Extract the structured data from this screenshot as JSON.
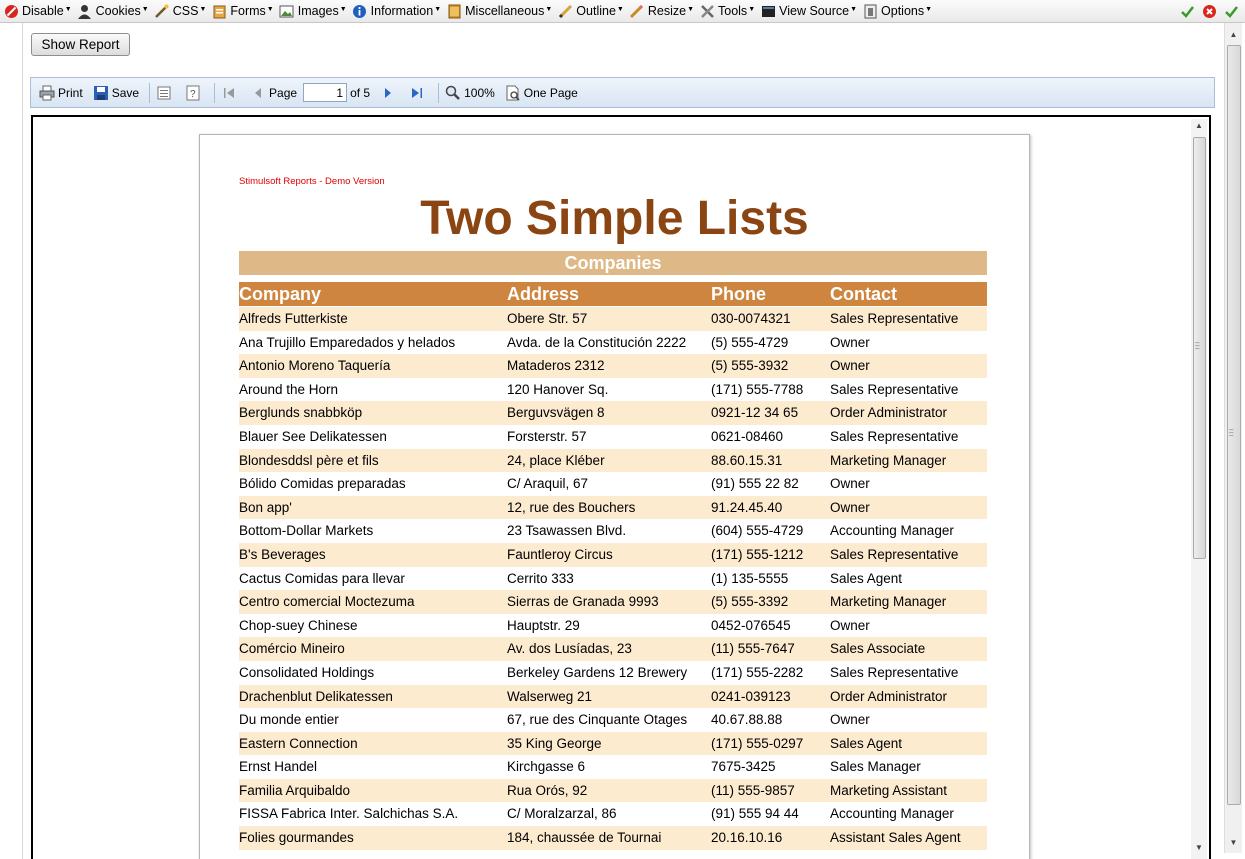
{
  "devbar": {
    "items": [
      {
        "label": "Disable",
        "icon": "disable-icon"
      },
      {
        "label": "Cookies",
        "icon": "cookies-icon"
      },
      {
        "label": "CSS",
        "icon": "css-icon"
      },
      {
        "label": "Forms",
        "icon": "forms-icon"
      },
      {
        "label": "Images",
        "icon": "images-icon"
      },
      {
        "label": "Information",
        "icon": "information-icon"
      },
      {
        "label": "Miscellaneous",
        "icon": "miscellaneous-icon"
      },
      {
        "label": "Outline",
        "icon": "outline-icon"
      },
      {
        "label": "Resize",
        "icon": "resize-icon"
      },
      {
        "label": "Tools",
        "icon": "tools-icon"
      },
      {
        "label": "View Source",
        "icon": "view-source-icon"
      },
      {
        "label": "Options",
        "icon": "options-icon"
      }
    ]
  },
  "show_report_label": "Show Report",
  "viewer": {
    "print_label": "Print",
    "save_label": "Save",
    "page_label": "Page",
    "page_value": "1",
    "page_of": "of 5",
    "zoom_label": "100%",
    "one_page_label": "One Page"
  },
  "report": {
    "demo_note": "Stimulsoft Reports - Demo Version",
    "title": "Two Simple Lists",
    "band_title": "Companies",
    "columns": [
      "Company",
      "Address",
      "Phone",
      "Contact"
    ],
    "rows": [
      [
        "Alfreds Futterkiste",
        "Obere Str. 57",
        "030-0074321",
        "Sales Representative"
      ],
      [
        "Ana Trujillo Emparedados y helados",
        "Avda. de la Constitución 2222",
        "(5) 555-4729",
        "Owner"
      ],
      [
        "Antonio Moreno Taquería",
        "Mataderos 2312",
        "(5) 555-3932",
        "Owner"
      ],
      [
        "Around the Horn",
        "120 Hanover Sq.",
        "(171) 555-7788",
        "Sales Representative"
      ],
      [
        "Berglunds snabbköp",
        "Berguvsvägen 8",
        "0921-12 34 65",
        "Order Administrator"
      ],
      [
        "Blauer See Delikatessen",
        "Forsterstr. 57",
        "0621-08460",
        "Sales Representative"
      ],
      [
        "Blondesddsl père et fils",
        "24, place Kléber",
        "88.60.15.31",
        "Marketing Manager"
      ],
      [
        "Bólido Comidas preparadas",
        "C/ Araquil, 67",
        "(91) 555 22 82",
        "Owner"
      ],
      [
        "Bon app'",
        "12, rue des Bouchers",
        "91.24.45.40",
        "Owner"
      ],
      [
        "Bottom-Dollar Markets",
        "23 Tsawassen Blvd.",
        "(604) 555-4729",
        "Accounting Manager"
      ],
      [
        "B's Beverages",
        "Fauntleroy Circus",
        "(171) 555-1212",
        "Sales Representative"
      ],
      [
        "Cactus Comidas para llevar",
        "Cerrito 333",
        "(1) 135-5555",
        "Sales Agent"
      ],
      [
        "Centro comercial Moctezuma",
        "Sierras de Granada 9993",
        "(5) 555-3392",
        "Marketing Manager"
      ],
      [
        "Chop-suey Chinese",
        "Hauptstr. 29",
        "0452-076545",
        "Owner"
      ],
      [
        "Comércio Mineiro",
        "Av. dos Lusíadas, 23",
        "(11) 555-7647",
        "Sales Associate"
      ],
      [
        "Consolidated Holdings",
        "Berkeley Gardens 12 Brewery",
        "(171) 555-2282",
        "Sales Representative"
      ],
      [
        "Drachenblut Delikatessen",
        "Walserweg 21",
        "0241-039123",
        "Order Administrator"
      ],
      [
        "Du monde entier",
        "67, rue des Cinquante Otages",
        "40.67.88.88",
        "Owner"
      ],
      [
        "Eastern Connection",
        "35 King George",
        "(171) 555-0297",
        "Sales Agent"
      ],
      [
        "Ernst Handel",
        "Kirchgasse 6",
        "7675-3425",
        "Sales Manager"
      ],
      [
        "Familia Arquibaldo",
        "Rua Orós, 92",
        "(11) 555-9857",
        "Marketing Assistant"
      ],
      [
        "FISSA Fabrica Inter. Salchichas S.A.",
        "C/ Moralzarzal, 86",
        "(91) 555 94 44",
        "Accounting Manager"
      ],
      [
        "Folies gourmandes",
        "184, chaussée de Tournai",
        "20.16.10.16",
        "Assistant Sales Agent"
      ]
    ]
  },
  "colors": {
    "title": "#8b4513",
    "band": "#deb887",
    "header": "#cd853f",
    "alt_row": "#fdebd0",
    "demo_note": "#e00000"
  }
}
